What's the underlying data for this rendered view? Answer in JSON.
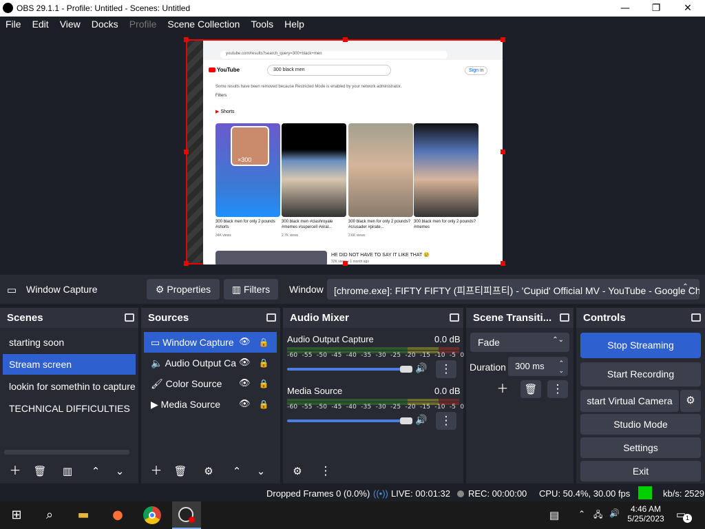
{
  "window": {
    "title": "OBS 29.1.1 - Profile: Untitled - Scenes: Untitled",
    "minimize": "—",
    "maximize": "❐",
    "close": "✕"
  },
  "menu": [
    "File",
    "Edit",
    "View",
    "Docks",
    "Profile",
    "Scene Collection",
    "Tools",
    "Help"
  ],
  "preview": {
    "url": "youtube.com/results?search_query=300+black+men",
    "logo": "YouTube",
    "search": "300 black men",
    "sign_in": "Sign in",
    "notice": "Some results have been removed because Restricted Mode is enabled by your network administrator.",
    "filters": "Filters",
    "shorts_label": "Shorts",
    "shorts": [
      {
        "caption": "300 black men for only 2 pounds #shorts",
        "views": "34K views",
        "overlay": "×300"
      },
      {
        "caption": "300 black men #clashroyale #memes #supercell #viral...",
        "views": "2.7K views",
        "overlay": ""
      },
      {
        "caption": "300 black men for only 2 pounds? #crusader #pirate...",
        "views": "2.6K views",
        "overlay": ""
      },
      {
        "caption": "300 black men for only 2 pounds? #memes",
        "views": "",
        "overlay": ""
      }
    ],
    "video_title": "HE DID NOT HAVE TO SAY IT LIKE THAT 😢",
    "video_meta": "32K views • 1 month ago"
  },
  "source_bar": {
    "source_name": "Window Capture",
    "properties": "Properties",
    "filters": "Filters",
    "window_label": "Window",
    "window_value": "[chrome.exe]: FIFTY FIFTY (피프티피프티) - 'Cupid' Official MV - YouTube - Google Chro"
  },
  "scenes": {
    "title": "Scenes",
    "items": [
      "starting soon",
      "Stream screen",
      "lookin for somethin to capture",
      "TECHNICAL DIFFICULTIES"
    ],
    "selected": "Stream screen"
  },
  "sources": {
    "title": "Sources",
    "items": [
      {
        "name": "Window Capture",
        "icon": "window-icon"
      },
      {
        "name": "Audio Output Ca",
        "icon": "speaker-icon"
      },
      {
        "name": "Color Source",
        "icon": "brush-icon"
      },
      {
        "name": "Media Source",
        "icon": "play-icon"
      }
    ],
    "selected": "Window Capture"
  },
  "mixer": {
    "title": "Audio Mixer",
    "channels": [
      {
        "name": "Audio Output Capture",
        "level": "0.0 dB",
        "volume_percent": 100
      },
      {
        "name": "Media Source",
        "level": "0.0 dB",
        "volume_percent": 100
      }
    ],
    "scale": [
      "-60",
      "-55",
      "-50",
      "-45",
      "-40",
      "-35",
      "-30",
      "-25",
      "-20",
      "-15",
      "-10",
      "-5",
      "0"
    ]
  },
  "transitions": {
    "title": "Scene Transiti...",
    "type": "Fade",
    "duration_label": "Duration",
    "duration_value": "300 ms"
  },
  "controls": {
    "title": "Controls",
    "stop_streaming": "Stop Streaming",
    "start_recording": "Start Recording",
    "start_virtual_camera": "start Virtual Camera",
    "studio_mode": "Studio Mode",
    "settings": "Settings",
    "exit": "Exit"
  },
  "status": {
    "dropped": "Dropped Frames 0 (0.0%)",
    "live": "LIVE: 00:01:32",
    "rec": "REC: 00:00:00",
    "cpu": "CPU: 50.4%, 30.00 fps",
    "kbps": "kb/s: 2529"
  },
  "taskbar": {
    "time": "4:46 AM",
    "date": "5/25/2023",
    "notification_count": "1"
  },
  "colors": {
    "accent": "#2f60d0",
    "panel": "#272a33",
    "background": "#1d1f26",
    "selection_border": "#e00000",
    "stream_ok": "#00d000"
  }
}
